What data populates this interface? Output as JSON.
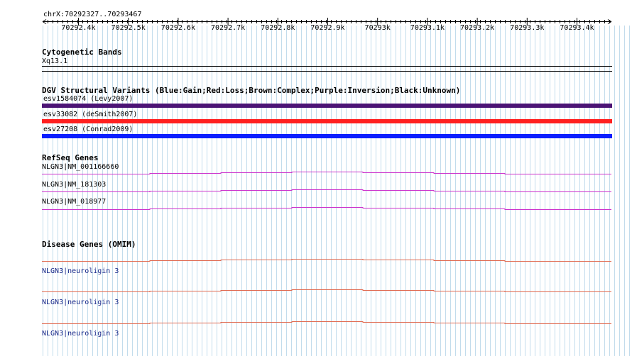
{
  "ruler": {
    "region": "chrX:70292327..70293467",
    "ticks": [
      "70292.4k",
      "70292.5k",
      "70292.6k",
      "70292.7k",
      "70292.8k",
      "70292.9k",
      "70293k",
      "70293.1k",
      "70293.2k",
      "70293.3k",
      "70293.4k"
    ]
  },
  "cytobands": {
    "title": "Cytogenetic Bands",
    "band": "Xq13.1"
  },
  "dgv": {
    "title": "DGV Structural Variants (Blue:Gain;Red:Loss;Brown:Complex;Purple:Inversion;Black:Unknown)",
    "variants": [
      {
        "label": "esv1584074 (Levy2007)",
        "color": "#4b1475"
      },
      {
        "label": "esv33082 (deSmith2007)",
        "color": "#ff2020"
      },
      {
        "label": "esv27208 (Conrad2009)",
        "color": "#0a1eff"
      }
    ]
  },
  "refseq": {
    "title": "RefSeq Genes",
    "color": "#cc33cc",
    "genes": [
      {
        "label": "NLGN3|NM_001166660"
      },
      {
        "label": "NLGN3|NM_181303"
      },
      {
        "label": "NLGN3|NM_018977"
      }
    ]
  },
  "omim": {
    "title": "Disease Genes (OMIM)",
    "color": "#e06a50",
    "genes": [
      {
        "label": "NLGN3|neuroligin 3"
      },
      {
        "label": "NLGN3|neuroligin 3"
      },
      {
        "label": "NLGN3|neuroligin 3"
      }
    ]
  },
  "colors": {
    "grid": "#c2dcec",
    "axis": "#000000"
  }
}
